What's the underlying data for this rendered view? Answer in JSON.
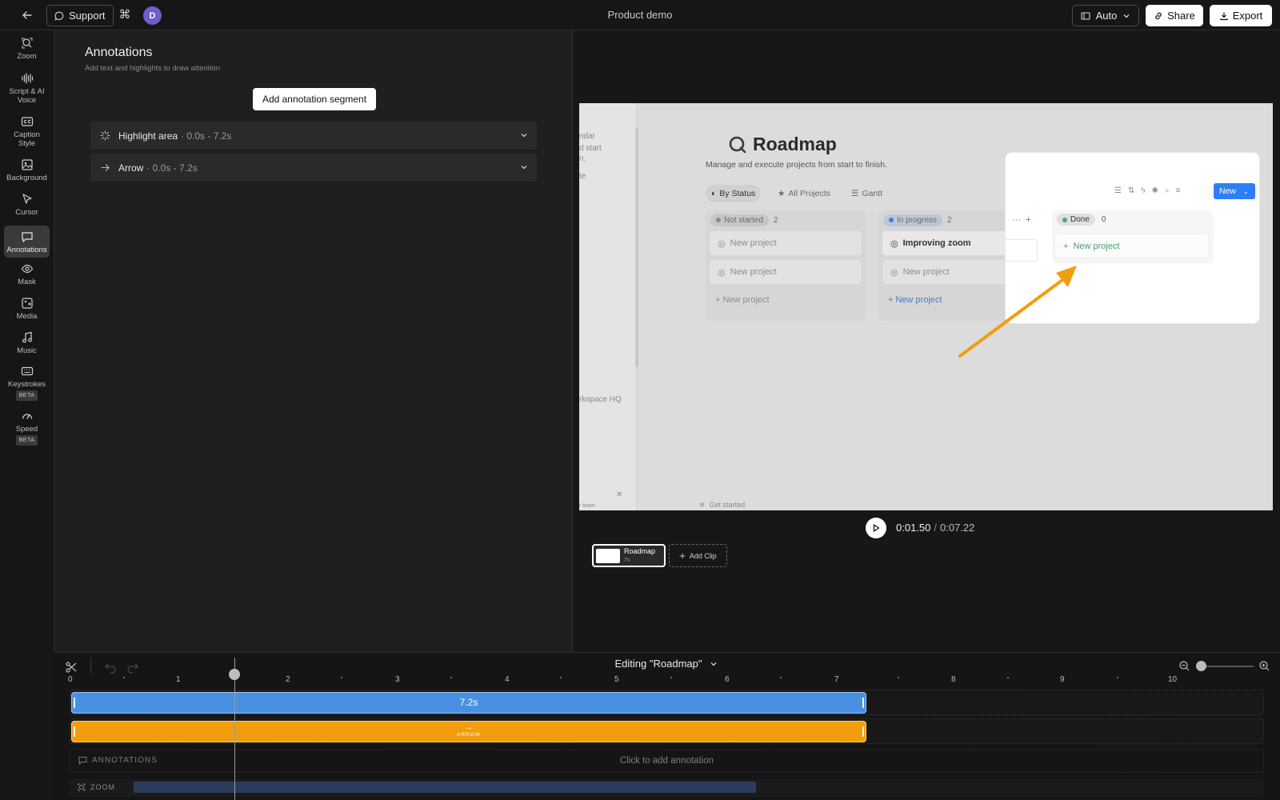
{
  "topbar": {
    "support_label": "Support",
    "avatar_initial": "D",
    "title": "Product demo",
    "aspect_label": "Auto",
    "share_label": "Share",
    "export_label": "Export"
  },
  "nav": {
    "items": [
      {
        "label": "Zoom",
        "icon": "zoom-icon"
      },
      {
        "label": "Script & AI Voice",
        "icon": "waveform-icon"
      },
      {
        "label": "Caption Style",
        "icon": "caption-icon"
      },
      {
        "label": "Background",
        "icon": "image-icon"
      },
      {
        "label": "Cursor",
        "icon": "cursor-icon"
      },
      {
        "label": "Annotations",
        "icon": "comment-icon",
        "active": true
      },
      {
        "label": "Mask",
        "icon": "eye-icon"
      },
      {
        "label": "Media",
        "icon": "media-icon"
      },
      {
        "label": "Music",
        "icon": "music-icon"
      },
      {
        "label": "Keystrokes",
        "icon": "keyboard-icon",
        "badge": "BETA"
      },
      {
        "label": "Speed",
        "icon": "speed-icon",
        "badge": "BETA"
      }
    ]
  },
  "panel": {
    "title": "Annotations",
    "subtitle": "Add text and highlights to draw attention",
    "add_button": "Add annotation segment",
    "segments": [
      {
        "name": "Highlight area",
        "range": "· 0.0s - 7.2s",
        "icon": "sparkle-icon"
      },
      {
        "name": "Arrow",
        "range": "· 0.0s - 7.2s",
        "icon": "arrow-right-icon"
      }
    ]
  },
  "video": {
    "title": "Roadmap",
    "subtitle": "Manage and execute projects from start to finish.",
    "tabs": [
      "By Status",
      "All Projects",
      "Gantt"
    ],
    "side_texts": [
      "ndar",
      "d start",
      "n.",
      "te",
      "rkspace HQ",
      "r team"
    ],
    "footer_text": "Get started",
    "columns": [
      {
        "name": "Not started",
        "count": "2",
        "cards": [
          "New project",
          "New project"
        ],
        "add": "New project"
      },
      {
        "name": "In progress",
        "count": "2",
        "cards": [
          "Improving zoom",
          "New project"
        ],
        "add": "New project"
      },
      {
        "name": "Done",
        "count": "0",
        "cards": [
          "New project"
        ]
      }
    ],
    "new_button": "New"
  },
  "player": {
    "current": "0:01.50",
    "separator": "/",
    "total": "0:07.22",
    "clip_name": "Roadmap",
    "clip_duration": "7s",
    "add_clip": "Add Clip"
  },
  "timeline": {
    "editing_label": "Editing \"Roadmap\"",
    "ruler": [
      "0",
      "1",
      "2",
      "3",
      "4",
      "5",
      "6",
      "7",
      "8",
      "9",
      "10"
    ],
    "clip_duration": "7.2s",
    "arrow_label": "ARROW",
    "annotations_label": "ANNOTATIONS",
    "annotations_hint": "Click to add annotation",
    "zoom_label": "ZOOM"
  },
  "colors": {
    "accent_blue": "#4a90e2",
    "accent_orange": "#f29d0c",
    "avatar": "#6b5fd0"
  }
}
